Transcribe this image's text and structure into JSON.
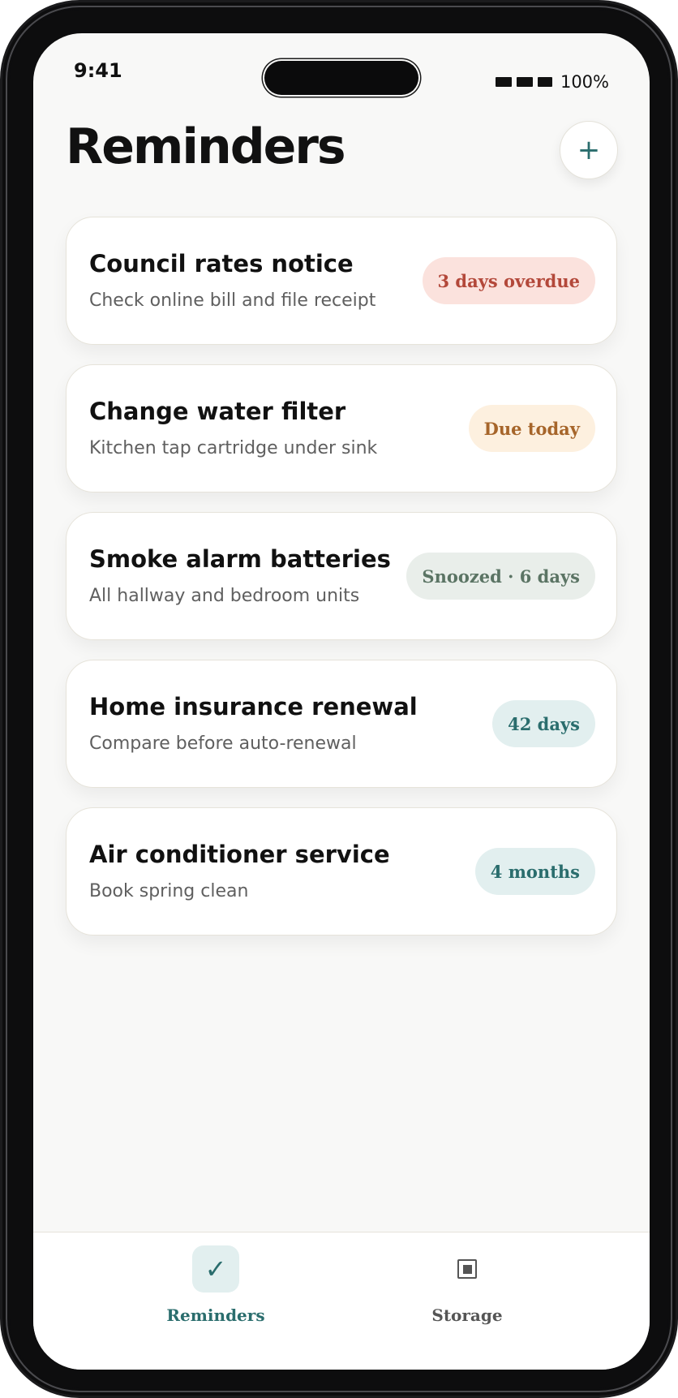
{
  "status_bar": {
    "time": "9:41",
    "battery": "100%"
  },
  "header": {
    "title": "Reminders",
    "add_label": "+"
  },
  "reminders": [
    {
      "title": "Council rates notice",
      "subtitle": "Check online bill and file receipt",
      "badge": "3 days overdue",
      "badge_bg": "#fbe2dd",
      "badge_color": "#b3483a"
    },
    {
      "title": "Change water filter",
      "subtitle": "Kitchen tap cartridge under sink",
      "badge": "Due today",
      "badge_bg": "#fdf0df",
      "badge_color": "#a6652a"
    },
    {
      "title": "Smoke alarm batteries",
      "subtitle": "All hallway and bedroom units",
      "badge": "Snoozed · 6 days",
      "badge_bg": "#e9eeea",
      "badge_color": "#5b7464"
    },
    {
      "title": "Home insurance renewal",
      "subtitle": "Compare before auto-renewal",
      "badge": "42 days",
      "badge_bg": "#e2efef",
      "badge_color": "#2a6d6d"
    },
    {
      "title": "Air conditioner service",
      "subtitle": "Book spring clean",
      "badge": "4 months",
      "badge_bg": "#e2efef",
      "badge_color": "#2a6d6d"
    }
  ],
  "tabs": [
    {
      "label": "Reminders",
      "icon": "check-icon",
      "glyph": "✓",
      "active": true
    },
    {
      "label": "Storage",
      "icon": "storage-box-icon",
      "active": false
    }
  ],
  "colors": {
    "accent": "#2a6d6d",
    "accent_tint": "#e2efef",
    "inactive_tab": "#555555"
  }
}
